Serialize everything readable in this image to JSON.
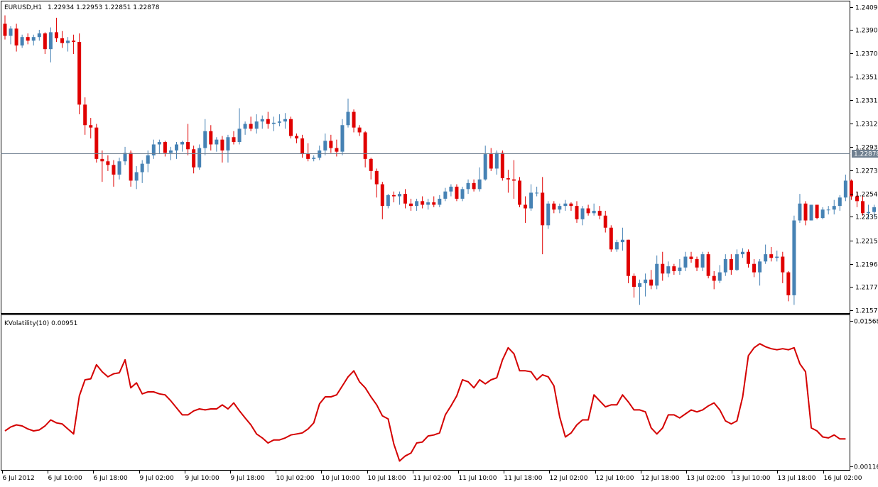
{
  "chart_data": {
    "type": "candlestick",
    "symbol_caption": "EURUSD,H1",
    "ohlc_caption": "1.22934 1.22953 1.22851 1.22878",
    "current_price": "1.22878",
    "price_axis": {
      "range": [
        1.2157,
        1.241
      ],
      "ticks": [
        "1.24090",
        "1.23900",
        "1.23705",
        "1.23510",
        "1.23315",
        "1.23125",
        "1.22930",
        "1.22735",
        "1.22540",
        "1.22350",
        "1.22155",
        "1.21960",
        "1.21770",
        "1.21575"
      ]
    },
    "candles": [
      {
        "o": 1.2395,
        "h": 1.2402,
        "l": 1.2382,
        "c": 1.2385
      },
      {
        "o": 1.2385,
        "h": 1.2393,
        "l": 1.2378,
        "c": 1.2391
      },
      {
        "o": 1.2391,
        "h": 1.2395,
        "l": 1.2372,
        "c": 1.2377
      },
      {
        "o": 1.2377,
        "h": 1.2386,
        "l": 1.2375,
        "c": 1.2384
      },
      {
        "o": 1.2384,
        "h": 1.2387,
        "l": 1.2378,
        "c": 1.2381
      },
      {
        "o": 1.2381,
        "h": 1.2386,
        "l": 1.2377,
        "c": 1.2384
      },
      {
        "o": 1.2384,
        "h": 1.239,
        "l": 1.2381,
        "c": 1.2387
      },
      {
        "o": 1.2387,
        "h": 1.2388,
        "l": 1.237,
        "c": 1.2374
      },
      {
        "o": 1.2374,
        "h": 1.2392,
        "l": 1.2363,
        "c": 1.2388
      },
      {
        "o": 1.2388,
        "h": 1.24,
        "l": 1.238,
        "c": 1.2383
      },
      {
        "o": 1.2383,
        "h": 1.2389,
        "l": 1.2375,
        "c": 1.2379
      },
      {
        "o": 1.2379,
        "h": 1.2384,
        "l": 1.2372,
        "c": 1.2381
      },
      {
        "o": 1.2381,
        "h": 1.2386,
        "l": 1.237,
        "c": 1.238
      },
      {
        "o": 1.238,
        "h": 1.2387,
        "l": 1.232,
        "c": 1.2328
      },
      {
        "o": 1.2328,
        "h": 1.2334,
        "l": 1.2303,
        "c": 1.2311
      },
      {
        "o": 1.2311,
        "h": 1.2317,
        "l": 1.23,
        "c": 1.2309
      },
      {
        "o": 1.2309,
        "h": 1.2312,
        "l": 1.228,
        "c": 1.2283
      },
      {
        "o": 1.2283,
        "h": 1.229,
        "l": 1.2264,
        "c": 1.2281
      },
      {
        "o": 1.2281,
        "h": 1.2286,
        "l": 1.2273,
        "c": 1.2278
      },
      {
        "o": 1.2278,
        "h": 1.2282,
        "l": 1.226,
        "c": 1.227
      },
      {
        "o": 1.227,
        "h": 1.2284,
        "l": 1.2266,
        "c": 1.2281
      },
      {
        "o": 1.2281,
        "h": 1.2293,
        "l": 1.2278,
        "c": 1.2288
      },
      {
        "o": 1.2288,
        "h": 1.229,
        "l": 1.226,
        "c": 1.2265
      },
      {
        "o": 1.2265,
        "h": 1.2277,
        "l": 1.2258,
        "c": 1.2272
      },
      {
        "o": 1.2272,
        "h": 1.2282,
        "l": 1.2263,
        "c": 1.2279
      },
      {
        "o": 1.2279,
        "h": 1.229,
        "l": 1.2272,
        "c": 1.2286
      },
      {
        "o": 1.2286,
        "h": 1.2299,
        "l": 1.2283,
        "c": 1.2295
      },
      {
        "o": 1.2295,
        "h": 1.2299,
        "l": 1.2287,
        "c": 1.2297
      },
      {
        "o": 1.2297,
        "h": 1.2298,
        "l": 1.2285,
        "c": 1.2288
      },
      {
        "o": 1.2288,
        "h": 1.2293,
        "l": 1.2282,
        "c": 1.229
      },
      {
        "o": 1.229,
        "h": 1.2297,
        "l": 1.2283,
        "c": 1.2295
      },
      {
        "o": 1.2295,
        "h": 1.2298,
        "l": 1.2289,
        "c": 1.2297
      },
      {
        "o": 1.2297,
        "h": 1.2312,
        "l": 1.2286,
        "c": 1.2291
      },
      {
        "o": 1.2291,
        "h": 1.2294,
        "l": 1.2271,
        "c": 1.2276
      },
      {
        "o": 1.2276,
        "h": 1.2295,
        "l": 1.2274,
        "c": 1.2292
      },
      {
        "o": 1.2292,
        "h": 1.2316,
        "l": 1.2286,
        "c": 1.2306
      },
      {
        "o": 1.2306,
        "h": 1.2311,
        "l": 1.229,
        "c": 1.2295
      },
      {
        "o": 1.2295,
        "h": 1.2301,
        "l": 1.2289,
        "c": 1.2299
      },
      {
        "o": 1.2299,
        "h": 1.2302,
        "l": 1.228,
        "c": 1.229
      },
      {
        "o": 1.229,
        "h": 1.2303,
        "l": 1.228,
        "c": 1.2301
      },
      {
        "o": 1.2301,
        "h": 1.2306,
        "l": 1.2295,
        "c": 1.2297
      },
      {
        "o": 1.2297,
        "h": 1.2325,
        "l": 1.2295,
        "c": 1.2308
      },
      {
        "o": 1.2308,
        "h": 1.2314,
        "l": 1.2303,
        "c": 1.2312
      },
      {
        "o": 1.2312,
        "h": 1.2318,
        "l": 1.2306,
        "c": 1.2308
      },
      {
        "o": 1.2308,
        "h": 1.232,
        "l": 1.2304,
        "c": 1.2314
      },
      {
        "o": 1.2314,
        "h": 1.2319,
        "l": 1.2308,
        "c": 1.2316
      },
      {
        "o": 1.2316,
        "h": 1.2322,
        "l": 1.2308,
        "c": 1.2312
      },
      {
        "o": 1.2312,
        "h": 1.2318,
        "l": 1.2306,
        "c": 1.2313
      },
      {
        "o": 1.2313,
        "h": 1.232,
        "l": 1.231,
        "c": 1.2314
      },
      {
        "o": 1.2314,
        "h": 1.2321,
        "l": 1.2308,
        "c": 1.2316
      },
      {
        "o": 1.2316,
        "h": 1.2318,
        "l": 1.23,
        "c": 1.2302
      },
      {
        "o": 1.2302,
        "h": 1.2304,
        "l": 1.2296,
        "c": 1.23
      },
      {
        "o": 1.23,
        "h": 1.2303,
        "l": 1.2284,
        "c": 1.2287
      },
      {
        "o": 1.2287,
        "h": 1.2296,
        "l": 1.2281,
        "c": 1.2283
      },
      {
        "o": 1.2283,
        "h": 1.2286,
        "l": 1.2281,
        "c": 1.2284
      },
      {
        "o": 1.2284,
        "h": 1.2294,
        "l": 1.2282,
        "c": 1.229
      },
      {
        "o": 1.229,
        "h": 1.2304,
        "l": 1.2286,
        "c": 1.2298
      },
      {
        "o": 1.2298,
        "h": 1.2303,
        "l": 1.2288,
        "c": 1.2292
      },
      {
        "o": 1.2292,
        "h": 1.2299,
        "l": 1.2285,
        "c": 1.2289
      },
      {
        "o": 1.2289,
        "h": 1.2316,
        "l": 1.2286,
        "c": 1.2311
      },
      {
        "o": 1.2311,
        "h": 1.2333,
        "l": 1.2309,
        "c": 1.2322
      },
      {
        "o": 1.2322,
        "h": 1.2324,
        "l": 1.2305,
        "c": 1.2309
      },
      {
        "o": 1.2309,
        "h": 1.2311,
        "l": 1.2302,
        "c": 1.2305
      },
      {
        "o": 1.2305,
        "h": 1.2306,
        "l": 1.2276,
        "c": 1.2283
      },
      {
        "o": 1.2283,
        "h": 1.2284,
        "l": 1.2266,
        "c": 1.2273
      },
      {
        "o": 1.2273,
        "h": 1.2275,
        "l": 1.2251,
        "c": 1.2262
      },
      {
        "o": 1.2262,
        "h": 1.2264,
        "l": 1.2233,
        "c": 1.2244
      },
      {
        "o": 1.2244,
        "h": 1.2254,
        "l": 1.2242,
        "c": 1.2253
      },
      {
        "o": 1.2253,
        "h": 1.2256,
        "l": 1.2247,
        "c": 1.2252
      },
      {
        "o": 1.2252,
        "h": 1.2256,
        "l": 1.2245,
        "c": 1.2254
      },
      {
        "o": 1.2254,
        "h": 1.2258,
        "l": 1.2242,
        "c": 1.2246
      },
      {
        "o": 1.2246,
        "h": 1.225,
        "l": 1.224,
        "c": 1.2244
      },
      {
        "o": 1.2244,
        "h": 1.225,
        "l": 1.224,
        "c": 1.2248
      },
      {
        "o": 1.2248,
        "h": 1.2252,
        "l": 1.2242,
        "c": 1.2245
      },
      {
        "o": 1.2245,
        "h": 1.225,
        "l": 1.2241,
        "c": 1.2247
      },
      {
        "o": 1.2247,
        "h": 1.2252,
        "l": 1.2243,
        "c": 1.2245
      },
      {
        "o": 1.2245,
        "h": 1.2253,
        "l": 1.2243,
        "c": 1.225
      },
      {
        "o": 1.225,
        "h": 1.2259,
        "l": 1.2248,
        "c": 1.2256
      },
      {
        "o": 1.2256,
        "h": 1.2262,
        "l": 1.2252,
        "c": 1.226
      },
      {
        "o": 1.226,
        "h": 1.2262,
        "l": 1.2248,
        "c": 1.225
      },
      {
        "o": 1.225,
        "h": 1.226,
        "l": 1.2248,
        "c": 1.2258
      },
      {
        "o": 1.2258,
        "h": 1.2266,
        "l": 1.2254,
        "c": 1.2263
      },
      {
        "o": 1.2263,
        "h": 1.2266,
        "l": 1.2256,
        "c": 1.2258
      },
      {
        "o": 1.2258,
        "h": 1.2276,
        "l": 1.2256,
        "c": 1.2266
      },
      {
        "o": 1.2266,
        "h": 1.2294,
        "l": 1.2265,
        "c": 1.2287
      },
      {
        "o": 1.2287,
        "h": 1.2292,
        "l": 1.2273,
        "c": 1.2275
      },
      {
        "o": 1.2275,
        "h": 1.229,
        "l": 1.227,
        "c": 1.2288
      },
      {
        "o": 1.2288,
        "h": 1.229,
        "l": 1.2265,
        "c": 1.2267
      },
      {
        "o": 1.2267,
        "h": 1.2274,
        "l": 1.2255,
        "c": 1.2266
      },
      {
        "o": 1.2266,
        "h": 1.2282,
        "l": 1.225,
        "c": 1.2265
      },
      {
        "o": 1.2265,
        "h": 1.2268,
        "l": 1.2243,
        "c": 1.2245
      },
      {
        "o": 1.2245,
        "h": 1.2252,
        "l": 1.223,
        "c": 1.2242
      },
      {
        "o": 1.2242,
        "h": 1.2262,
        "l": 1.224,
        "c": 1.2255
      },
      {
        "o": 1.2255,
        "h": 1.226,
        "l": 1.2252,
        "c": 1.2255
      },
      {
        "o": 1.2255,
        "h": 1.2268,
        "l": 1.2204,
        "c": 1.2228
      },
      {
        "o": 1.2228,
        "h": 1.2248,
        "l": 1.2225,
        "c": 1.2246
      },
      {
        "o": 1.2246,
        "h": 1.2248,
        "l": 1.2238,
        "c": 1.2241
      },
      {
        "o": 1.2241,
        "h": 1.2246,
        "l": 1.2238,
        "c": 1.2244
      },
      {
        "o": 1.2244,
        "h": 1.2249,
        "l": 1.224,
        "c": 1.2246
      },
      {
        "o": 1.2246,
        "h": 1.2247,
        "l": 1.224,
        "c": 1.2244
      },
      {
        "o": 1.2244,
        "h": 1.2248,
        "l": 1.223,
        "c": 1.2233
      },
      {
        "o": 1.2233,
        "h": 1.2244,
        "l": 1.2228,
        "c": 1.2242
      },
      {
        "o": 1.2242,
        "h": 1.2245,
        "l": 1.2236,
        "c": 1.2238
      },
      {
        "o": 1.2238,
        "h": 1.2246,
        "l": 1.2236,
        "c": 1.224
      },
      {
        "o": 1.224,
        "h": 1.2244,
        "l": 1.2233,
        "c": 1.2236
      },
      {
        "o": 1.2236,
        "h": 1.224,
        "l": 1.2222,
        "c": 1.2226
      },
      {
        "o": 1.2226,
        "h": 1.2228,
        "l": 1.2206,
        "c": 1.2208
      },
      {
        "o": 1.2208,
        "h": 1.2216,
        "l": 1.2206,
        "c": 1.2214
      },
      {
        "o": 1.2214,
        "h": 1.2226,
        "l": 1.2207,
        "c": 1.2216
      },
      {
        "o": 1.2216,
        "h": 1.2216,
        "l": 1.218,
        "c": 1.2186
      },
      {
        "o": 1.2186,
        "h": 1.2188,
        "l": 1.2168,
        "c": 1.2177
      },
      {
        "o": 1.2177,
        "h": 1.2183,
        "l": 1.2162,
        "c": 1.218
      },
      {
        "o": 1.218,
        "h": 1.2188,
        "l": 1.2169,
        "c": 1.2183
      },
      {
        "o": 1.2183,
        "h": 1.2191,
        "l": 1.2175,
        "c": 1.2178
      },
      {
        "o": 1.2178,
        "h": 1.2203,
        "l": 1.2175,
        "c": 1.2196
      },
      {
        "o": 1.2196,
        "h": 1.2206,
        "l": 1.2182,
        "c": 1.2188
      },
      {
        "o": 1.2188,
        "h": 1.2198,
        "l": 1.2185,
        "c": 1.2194
      },
      {
        "o": 1.2194,
        "h": 1.2196,
        "l": 1.2187,
        "c": 1.219
      },
      {
        "o": 1.219,
        "h": 1.22,
        "l": 1.2187,
        "c": 1.2193
      },
      {
        "o": 1.2193,
        "h": 1.2206,
        "l": 1.219,
        "c": 1.2202
      },
      {
        "o": 1.2202,
        "h": 1.2206,
        "l": 1.2197,
        "c": 1.22
      },
      {
        "o": 1.22,
        "h": 1.2202,
        "l": 1.219,
        "c": 1.2193
      },
      {
        "o": 1.2193,
        "h": 1.2206,
        "l": 1.219,
        "c": 1.2204
      },
      {
        "o": 1.2204,
        "h": 1.2206,
        "l": 1.2184,
        "c": 1.2186
      },
      {
        "o": 1.2186,
        "h": 1.219,
        "l": 1.2175,
        "c": 1.2182
      },
      {
        "o": 1.2182,
        "h": 1.2195,
        "l": 1.218,
        "c": 1.2189
      },
      {
        "o": 1.2189,
        "h": 1.2204,
        "l": 1.2186,
        "c": 1.22
      },
      {
        "o": 1.22,
        "h": 1.2204,
        "l": 1.2187,
        "c": 1.2191
      },
      {
        "o": 1.2191,
        "h": 1.2208,
        "l": 1.219,
        "c": 1.2204
      },
      {
        "o": 1.2204,
        "h": 1.2209,
        "l": 1.2201,
        "c": 1.2206
      },
      {
        "o": 1.2206,
        "h": 1.2208,
        "l": 1.2193,
        "c": 1.2196
      },
      {
        "o": 1.2196,
        "h": 1.22,
        "l": 1.2185,
        "c": 1.2189
      },
      {
        "o": 1.2189,
        "h": 1.22,
        "l": 1.2178,
        "c": 1.2198
      },
      {
        "o": 1.2198,
        "h": 1.2212,
        "l": 1.2196,
        "c": 1.2204
      },
      {
        "o": 1.2204,
        "h": 1.221,
        "l": 1.2198,
        "c": 1.2201
      },
      {
        "o": 1.2201,
        "h": 1.2207,
        "l": 1.2198,
        "c": 1.2202
      },
      {
        "o": 1.2202,
        "h": 1.2206,
        "l": 1.218,
        "c": 1.2189
      },
      {
        "o": 1.2189,
        "h": 1.219,
        "l": 1.2165,
        "c": 1.217
      },
      {
        "o": 1.217,
        "h": 1.2236,
        "l": 1.2162,
        "c": 1.2232
      },
      {
        "o": 1.2232,
        "h": 1.2254,
        "l": 1.223,
        "c": 1.2246
      },
      {
        "o": 1.2246,
        "h": 1.2248,
        "l": 1.2228,
        "c": 1.2232
      },
      {
        "o": 1.2232,
        "h": 1.2245,
        "l": 1.2232,
        "c": 1.2245
      },
      {
        "o": 1.2245,
        "h": 1.2245,
        "l": 1.2233,
        "c": 1.2234
      },
      {
        "o": 1.2234,
        "h": 1.2243,
        "l": 1.2233,
        "c": 1.2241
      },
      {
        "o": 1.2241,
        "h": 1.2244,
        "l": 1.2237,
        "c": 1.2241
      },
      {
        "o": 1.2241,
        "h": 1.2249,
        "l": 1.2237,
        "c": 1.2244
      },
      {
        "o": 1.2244,
        "h": 1.2253,
        "l": 1.224,
        "c": 1.2251
      },
      {
        "o": 1.2251,
        "h": 1.227,
        "l": 1.2248,
        "c": 1.2265
      },
      {
        "o": 1.2265,
        "h": 1.2266,
        "l": 1.2249,
        "c": 1.2252
      },
      {
        "o": 1.2252,
        "h": 1.2256,
        "l": 1.2243,
        "c": 1.2248
      },
      {
        "o": 1.2248,
        "h": 1.2252,
        "l": 1.2236,
        "c": 1.2238
      },
      {
        "o": 1.2238,
        "h": 1.2245,
        "l": 1.2233,
        "c": 1.2239
      },
      {
        "o": 1.2239,
        "h": 1.2245,
        "l": 1.2234,
        "c": 1.2243
      },
      {
        "o": 1.2243,
        "h": 1.2247,
        "l": 1.2238,
        "c": 1.2243
      },
      {
        "o": 1.2243,
        "h": 1.2246,
        "l": 1.2233,
        "c": 1.2238
      }
    ],
    "volatility": {
      "caption": "KVolatility(10) 0.00951",
      "range": [
        0.00116,
        0.01568
      ],
      "ticks": [
        "0.01568",
        "0.00116"
      ],
      "values": [
        0.0047,
        0.0051,
        0.0053,
        0.0052,
        0.0049,
        0.0047,
        0.0048,
        0.0052,
        0.0058,
        0.0055,
        0.0054,
        0.0049,
        0.0044,
        0.0082,
        0.0098,
        0.0099,
        0.0113,
        0.0106,
        0.0101,
        0.0104,
        0.0105,
        0.0118,
        0.009,
        0.0095,
        0.0084,
        0.0086,
        0.0086,
        0.0084,
        0.0083,
        0.0077,
        0.007,
        0.0063,
        0.0063,
        0.0067,
        0.0069,
        0.0068,
        0.0069,
        0.0069,
        0.0073,
        0.0069,
        0.0075,
        0.0067,
        0.006,
        0.0053,
        0.0044,
        0.004,
        0.0035,
        0.0038,
        0.0038,
        0.004,
        0.0043,
        0.0044,
        0.0045,
        0.0049,
        0.0055,
        0.0074,
        0.0081,
        0.0081,
        0.0083,
        0.0092,
        0.0101,
        0.0107,
        0.0096,
        0.009,
        0.0081,
        0.0073,
        0.0062,
        0.0059,
        0.0034,
        0.0017,
        0.0022,
        0.0025,
        0.0035,
        0.0036,
        0.0042,
        0.0043,
        0.0045,
        0.0063,
        0.0072,
        0.0082,
        0.0098,
        0.0096,
        0.009,
        0.0098,
        0.0094,
        0.0098,
        0.01,
        0.0118,
        0.013,
        0.0124,
        0.0107,
        0.0107,
        0.0106,
        0.0098,
        0.0103,
        0.0101,
        0.0092,
        0.0061,
        0.0041,
        0.0045,
        0.0053,
        0.0058,
        0.0058,
        0.0083,
        0.0077,
        0.0071,
        0.0073,
        0.0073,
        0.0083,
        0.0076,
        0.0068,
        0.0068,
        0.0066,
        0.005,
        0.0044,
        0.005,
        0.0063,
        0.0063,
        0.006,
        0.0064,
        0.0068,
        0.0066,
        0.0068,
        0.0072,
        0.0075,
        0.0068,
        0.0057,
        0.0054,
        0.0057,
        0.0081,
        0.0122,
        0.013,
        0.0134,
        0.0131,
        0.0129,
        0.0128,
        0.0129,
        0.0128,
        0.013,
        0.0114,
        0.0106,
        0.005,
        0.0047,
        0.0041,
        0.004,
        0.0043,
        0.0039,
        0.0039
      ]
    },
    "time_labels": [
      "6 Jul 2012",
      "6 Jul 10:00",
      "6 Jul 18:00",
      "9 Jul 02:00",
      "9 Jul 10:00",
      "9 Jul 18:00",
      "10 Jul 02:00",
      "10 Jul 10:00",
      "10 Jul 18:00",
      "11 Jul 02:00",
      "11 Jul 10:00",
      "11 Jul 18:00",
      "12 Jul 02:00",
      "12 Jul 10:00",
      "12 Jul 18:00",
      "13 Jul 02:00",
      "13 Jul 10:00",
      "13 Jul 18:00",
      "16 Jul 02:00"
    ],
    "colors": {
      "bull": "#4682B4",
      "bear": "#E00000",
      "indicator": "#D40000",
      "price_line": "#708090"
    },
    "grid": false
  }
}
